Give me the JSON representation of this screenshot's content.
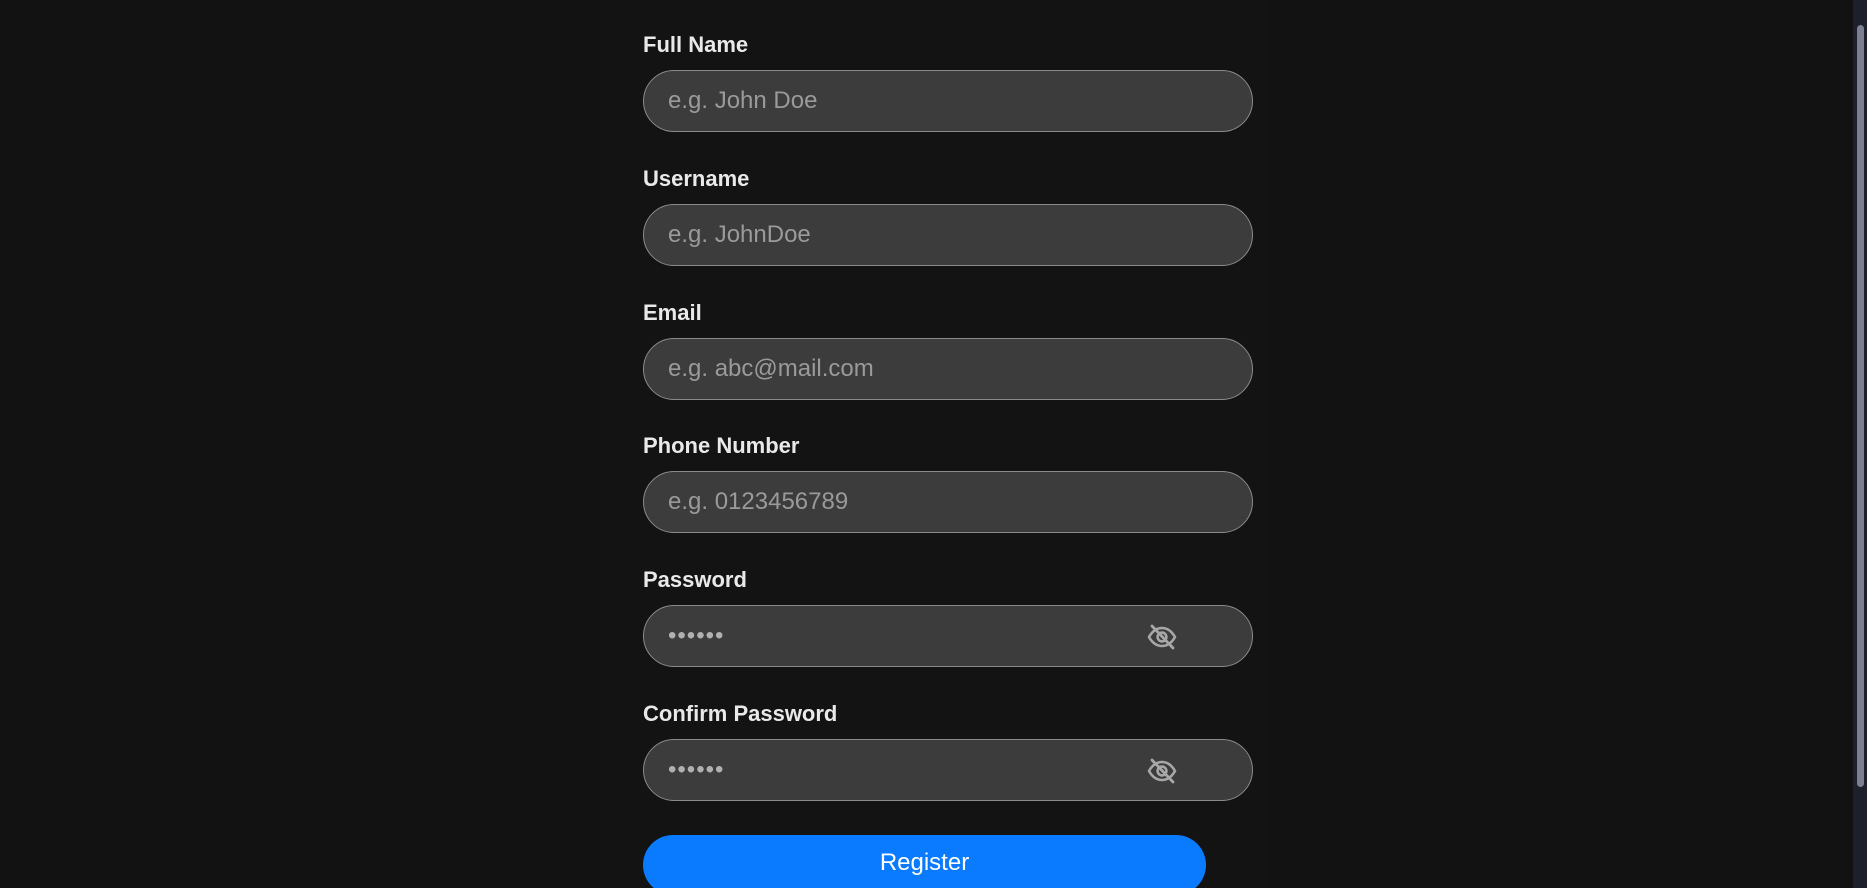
{
  "form": {
    "full_name": {
      "label": "Full Name",
      "placeholder": "e.g. John Doe",
      "value": ""
    },
    "username": {
      "label": "Username",
      "placeholder": "e.g. JohnDoe",
      "value": ""
    },
    "email": {
      "label": "Email",
      "placeholder": "e.g. abc@mail.com",
      "value": ""
    },
    "phone": {
      "label": "Phone Number",
      "placeholder": "e.g. 0123456789",
      "value": ""
    },
    "password": {
      "label": "Password",
      "value": "••••••",
      "toggle_icon": "eye-slash-icon"
    },
    "confirm_password": {
      "label": "Confirm Password",
      "value": "••••••",
      "toggle_icon": "eye-slash-icon"
    },
    "register_label": "Register"
  },
  "colors": {
    "page_background": "#121212",
    "input_background": "#3c3c3c",
    "input_border": "#8a8a8a",
    "label_text": "#e9e9e9",
    "placeholder_text": "#9a9a9a",
    "primary_button": "#0a7bff",
    "scrollbar_thumb": "#7b7f92"
  }
}
